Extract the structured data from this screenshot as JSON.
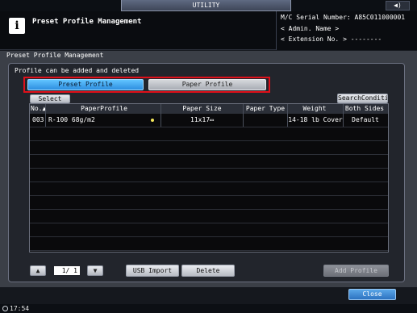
{
  "top": {
    "tab_label": "UTILITY",
    "speaker_icon": "◀)"
  },
  "header": {
    "title": "Preset Profile Management",
    "serial_line": "M/C Serial Number: A85C011000001",
    "admin_line": "< Admin. Name >",
    "extension_line": "< Extension No. >  --------"
  },
  "panel": {
    "title": "Preset Profile Management",
    "info_text": "Profile can be added and deleted",
    "tabs": {
      "preset": "Preset Profile",
      "paper": "Paper Profile"
    },
    "select_all": "Select All",
    "search": "SearchConditions"
  },
  "table": {
    "headers": {
      "no": "No.▲",
      "paper_profile": "PaperProfile",
      "paper_size": "Paper Size",
      "paper_type": "Paper Type",
      "weight": "Weight",
      "both_sides": "Both Sides"
    },
    "rows": [
      {
        "no": "003",
        "profile": "R-100  68g/m2",
        "size": "11x17▭",
        "type": "",
        "weight": "14-18 lb Cover",
        "both": "Default"
      }
    ]
  },
  "bottom": {
    "page": "1/  1",
    "up_icon": "▲",
    "down_icon": "▼",
    "usb_import": "USB Import",
    "delete": "Delete",
    "add_profile": "Add Profile",
    "close": "Close"
  },
  "status": {
    "time": "17:54"
  }
}
